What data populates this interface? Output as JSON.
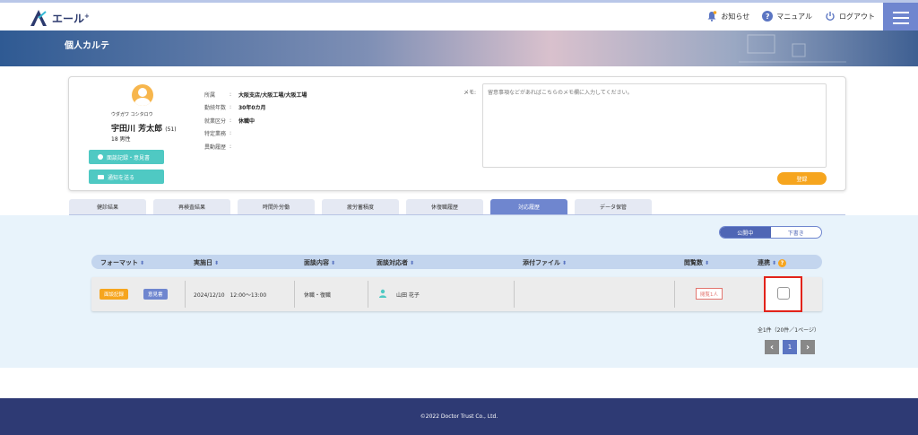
{
  "app": {
    "logo_text": "エール",
    "logo_sup": "+"
  },
  "nav": {
    "news": "お知らせ",
    "manual": "マニュアル",
    "logout": "ログアウト",
    "help_glyph": "?"
  },
  "page": {
    "title": "個人カルテ"
  },
  "profile": {
    "kana": "ウダガワ コシタロウ",
    "name": "宇田川 芳太郎",
    "age_paren": "(51)",
    "age_gender": "18 男性",
    "record_button": "面談記録・意見書",
    "notify_button": "通知を送る",
    "fields": [
      {
        "label": "所属",
        "colon": ":",
        "value": "大阪支店/大阪工場/大阪工場"
      },
      {
        "label": "勤続年数",
        "colon": ":",
        "value": "30年0カ月"
      },
      {
        "label": "就業区分",
        "colon": ":",
        "value": "休職中"
      },
      {
        "label": "特定業務",
        "colon": ":",
        "value": ""
      },
      {
        "label": "異動履歴",
        "colon": ":",
        "value": ""
      }
    ],
    "memo_label": "メモ:",
    "memo_placeholder": "留意事項などがあればこちらのメモ欄に入力してください。",
    "register_button": "登録"
  },
  "tabs": [
    {
      "label": "健診結果"
    },
    {
      "label": "再検査結果"
    },
    {
      "label": "時間外労働"
    },
    {
      "label": "疲労蓄積度"
    },
    {
      "label": "休復職履歴"
    },
    {
      "label": "対応履歴"
    },
    {
      "label": "データ保管"
    }
  ],
  "toggle": {
    "published": "公開中",
    "draft": "下書き"
  },
  "table": {
    "headers": {
      "format": "フォーマット",
      "date": "実施日",
      "content": "面談内容",
      "responder": "面談対応者",
      "attachment": "添付ファイル",
      "views": "閲覧数",
      "link": "連携"
    },
    "sort_glyph": "⬍",
    "help_glyph": "?",
    "rows": [
      {
        "tag1": "面談記録",
        "tag2": "意見書",
        "date": "2024/12/10　12:00〜13:00",
        "content": "休職・復職",
        "responder": "山田 花子",
        "views": "閲覧1人"
      }
    ]
  },
  "pagination": {
    "summary": "全1件（20件／1ページ）",
    "prev": "‹",
    "page": "1",
    "next": "›"
  },
  "footer": {
    "copyright": "©2022 Doctor Trust Co., Ltd."
  },
  "colors": {
    "accent": "#6f86cf",
    "teal": "#4fc9c3",
    "orange": "#f6a51e",
    "footer": "#2e3a74",
    "highlight": "#e2231a"
  }
}
